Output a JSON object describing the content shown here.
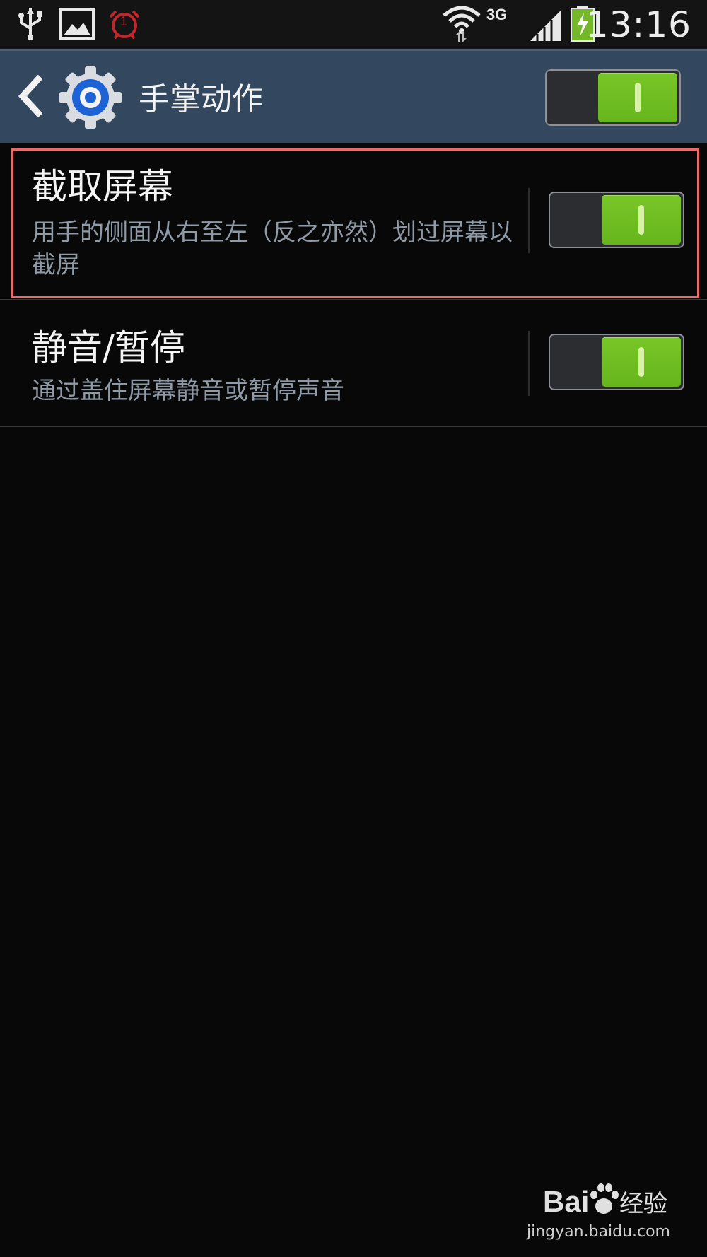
{
  "status_bar": {
    "time": "13:16",
    "network_label": "3G",
    "icons": [
      "usb-icon",
      "gallery-icon",
      "alarm-icon",
      "wifi-icon",
      "signal-icon",
      "battery-charging-icon"
    ],
    "alarm_badge": "1"
  },
  "action_bar": {
    "title": "手掌动作",
    "master_switch_on": true
  },
  "settings": [
    {
      "title": "截取屏幕",
      "summary": "用手的侧面从右至左（反之亦然）划过屏幕以截屏",
      "enabled": true,
      "highlighted": true
    },
    {
      "title": "静音/暂停",
      "summary": "通过盖住屏幕静音或暂停声音",
      "enabled": true,
      "highlighted": false
    }
  ],
  "colors": {
    "action_bar_bg": "#33475e",
    "switch_on": "#6cbd21",
    "highlight_border": "#e86a6a",
    "background": "#080808"
  },
  "watermark": {
    "brand": "Bai经验",
    "url": "jingyan.baidu.com"
  }
}
